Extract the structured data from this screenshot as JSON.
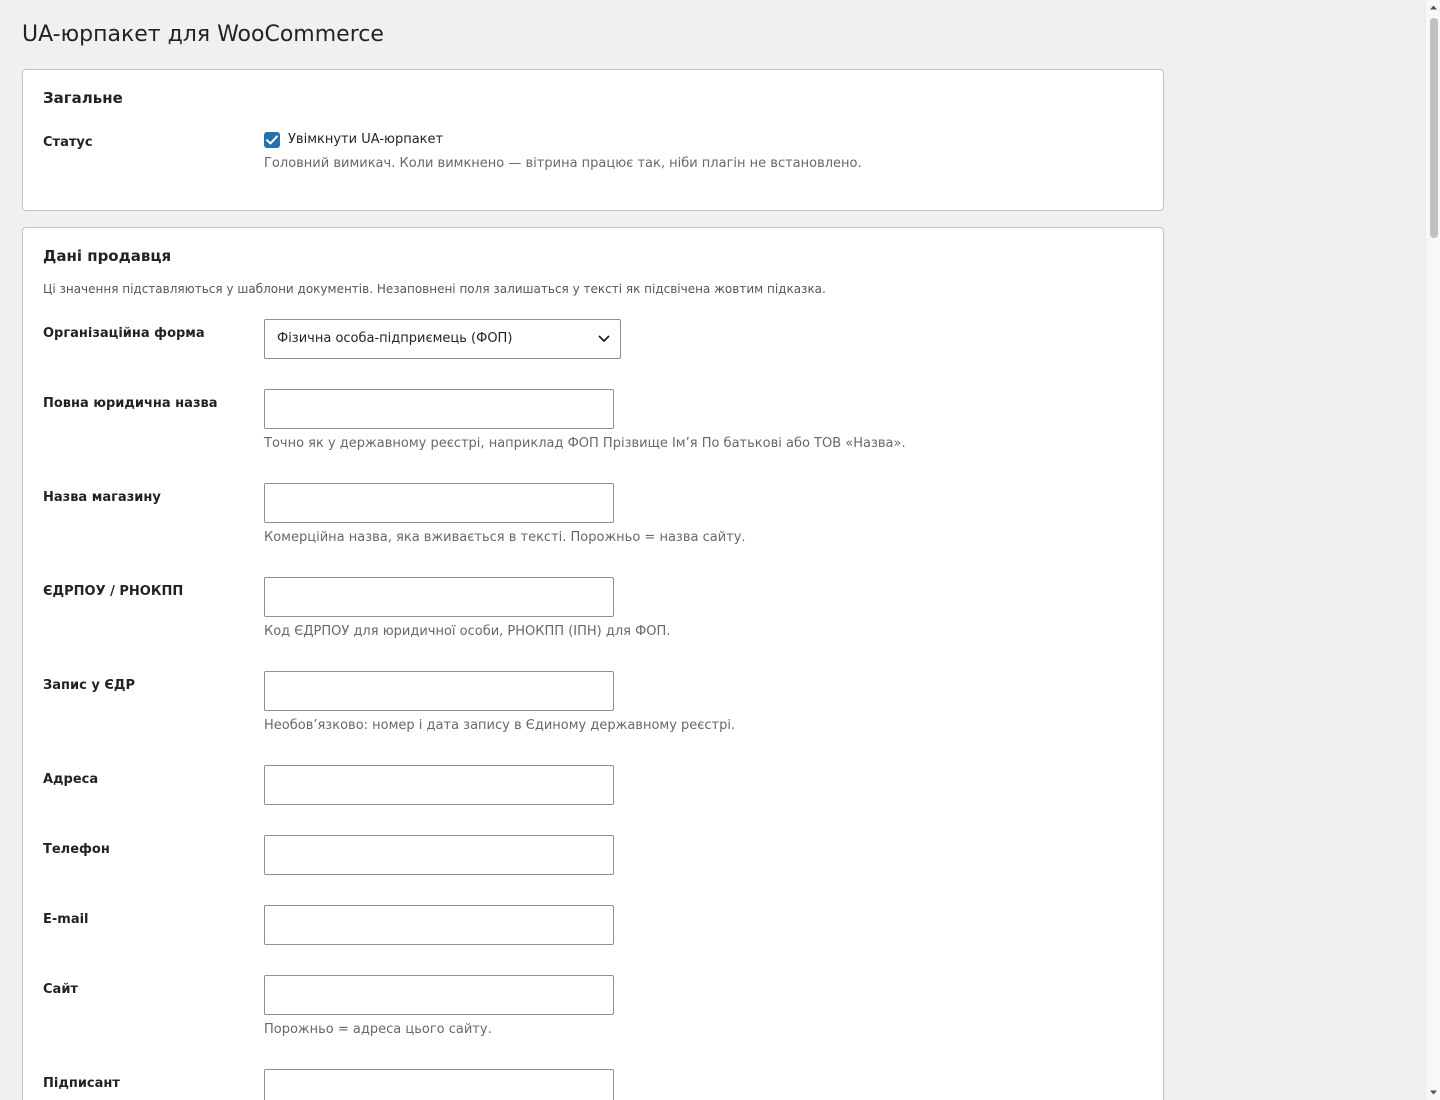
{
  "page": {
    "title": "UA-юрпакет для WooCommerce"
  },
  "general": {
    "heading": "Загальне",
    "status_label": "Статус",
    "enable_checkbox_label": "Увімкнути UA-юрпакет",
    "enable_checked": true,
    "status_hint": "Головний вимикач. Коли вимкнено — вітрина працює так, ніби плагін не встановлено."
  },
  "seller": {
    "heading": "Дані продавця",
    "description": "Ці значення підставляються у шаблони документів. Незаповнені поля залишаться у тексті як підсвічена жовтим підказка.",
    "org_form": {
      "label": "Організаційна форма",
      "selected": "Фізична особа-підприємець (ФОП)"
    },
    "legal_name": {
      "label": "Повна юридична назва",
      "value": "",
      "hint": "Точно як у державному реєстрі, наприклад ФОП Прізвище Ім’я По батькові або ТОВ «Назва»."
    },
    "shop_name": {
      "label": "Назва магазину",
      "value": "",
      "hint": "Комерційна назва, яка вживається в тексті. Порожньо = назва сайту."
    },
    "edrpou": {
      "label": "ЄДРПОУ / РНОКПП",
      "value": "",
      "hint": "Код ЄДРПОУ для юридичної особи, РНОКПП (ІПН) для ФОП."
    },
    "edr_record": {
      "label": "Запис у ЄДР",
      "value": "",
      "hint": "Необов’язково: номер і дата запису в Єдиному державному реєстрі."
    },
    "address": {
      "label": "Адреса",
      "value": ""
    },
    "phone": {
      "label": "Телефон",
      "value": ""
    },
    "email": {
      "label": "E-mail",
      "value": ""
    },
    "website": {
      "label": "Сайт",
      "value": "",
      "hint": "Порожньо = адреса цього сайту."
    },
    "signatory": {
      "label": "Підписант",
      "value": ""
    }
  },
  "colors": {
    "accent": "#2271b1",
    "border": "#c3c4c7",
    "input_border": "#8c8f94",
    "background": "#f0f0f1"
  }
}
